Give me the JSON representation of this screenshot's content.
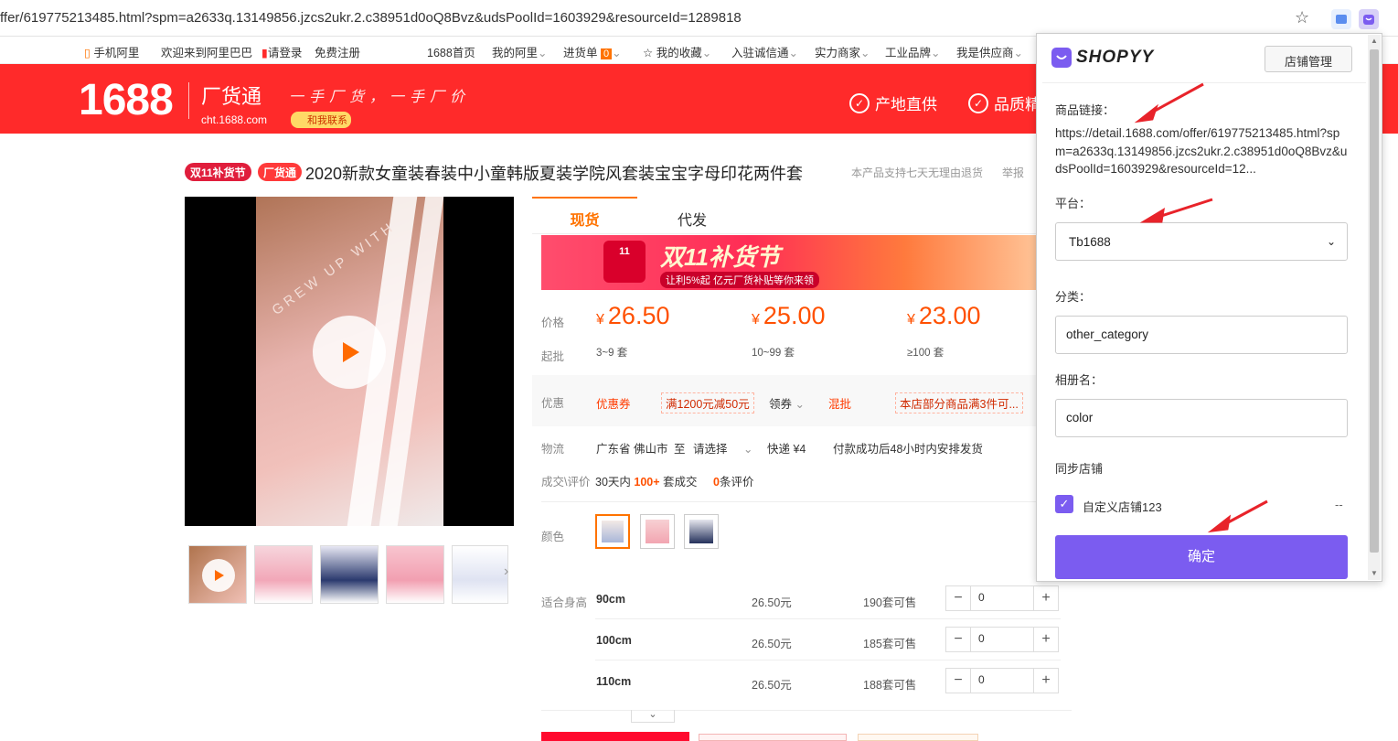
{
  "browser": {
    "url": "ffer/619775213485.html?spm=a2633q.13149856.jzcs2ukr.2.c38951d0oQ8Bvz&udsPoolId=1603929&resourceId=1289818",
    "bookmark_icon": "star-icon",
    "extension_icons": [
      "extension-icon",
      "shopyy-extension-icon"
    ]
  },
  "topnav": {
    "mobile": "手机阿里",
    "welcome": "欢迎来到阿里巴巴",
    "login": "请登录",
    "register": "免费注册",
    "home": "1688首页",
    "my_ali": "我的阿里",
    "cart": "进货单",
    "cart_count": "0",
    "favorites": "我的收藏",
    "join": "入驻诚信通",
    "merchants": "实力商家",
    "industrial": "工业品牌",
    "supplier": "我是供应商"
  },
  "header": {
    "logo": "1688",
    "brand": "厂货通",
    "domain": "cht.1688.com",
    "slogan": "一手厂货，一手厂价",
    "contact": "和我联系",
    "feature1": "产地直供",
    "feature2": "品质精"
  },
  "product": {
    "tag1": "双11补货节",
    "tag2": "厂货通",
    "title": "2020新款女童装春装中小童韩版夏装学院风套装宝宝字母印花两件套",
    "refund_note": "本产品支持七天无理由退货",
    "report": "举报",
    "video_text": "GREW UP WITH",
    "tabs": [
      "现货",
      "代发"
    ],
    "banner_title": "双11补货节",
    "banner_sub": "让利5%起 亿元厂货补贴等你来领",
    "price_label": "价格",
    "minq_label": "起批",
    "tiers": [
      {
        "currency": "¥",
        "price": "26.50",
        "qty": "3~9 套"
      },
      {
        "currency": "¥",
        "price": "25.00",
        "qty": "10~99 套"
      },
      {
        "currency": "¥",
        "price": "23.00",
        "qty": "≥100 套"
      }
    ],
    "promo_label": "优惠",
    "coupon": "优惠券",
    "coupon_value": "满1200元减50元",
    "get_coupon": "领券",
    "mixed": "混批",
    "mixed_value": "本店部分商品满3件可...",
    "logistics_label": "物流",
    "origin": "广东省 佛山市",
    "to": "至",
    "select": "请选择",
    "express": "快递 ¥4",
    "ship_note": "付款成功后48小时内安排发货",
    "deal_label": "成交\\评价",
    "deal_prefix": "30天内",
    "deal_count": "100+",
    "deal_suffix": "套成交",
    "review_count": "0",
    "review_suffix": "条评价",
    "color_label": "颜色",
    "size_label": "适合身高",
    "sizes": [
      {
        "size": "90cm",
        "price": "26.50元",
        "stock": "190",
        "stock_unit": "套可售",
        "qty": "0"
      },
      {
        "size": "100cm",
        "price": "26.50元",
        "stock": "185",
        "stock_unit": "套可售",
        "qty": "0"
      },
      {
        "size": "110cm",
        "price": "26.50元",
        "stock": "188",
        "stock_unit": "套可售",
        "qty": "0"
      }
    ]
  },
  "popup": {
    "brand": "SHOPYY",
    "store_manage": "店铺管理",
    "link_label": "商品链接：",
    "link_value": "https://detail.1688.com/offer/619775213485.html?spm=a2633q.13149856.jzcs2ukr.2.c38951d0oQ8Bvz&udsPoolId=1603929&resourceId=12...",
    "platform_label": "平台：",
    "platform_value": "Tb1688",
    "category_label": "分类：",
    "category_value": "other_category",
    "album_label": "相册名：",
    "album_value": "color",
    "sync_label": "同步店铺",
    "store_name": "自定义店铺123",
    "store_extra": "--",
    "confirm": "确定"
  },
  "colors": {
    "accent": "#ff2a2a",
    "orange": "#ff7300",
    "purple": "#7b5cf0"
  }
}
